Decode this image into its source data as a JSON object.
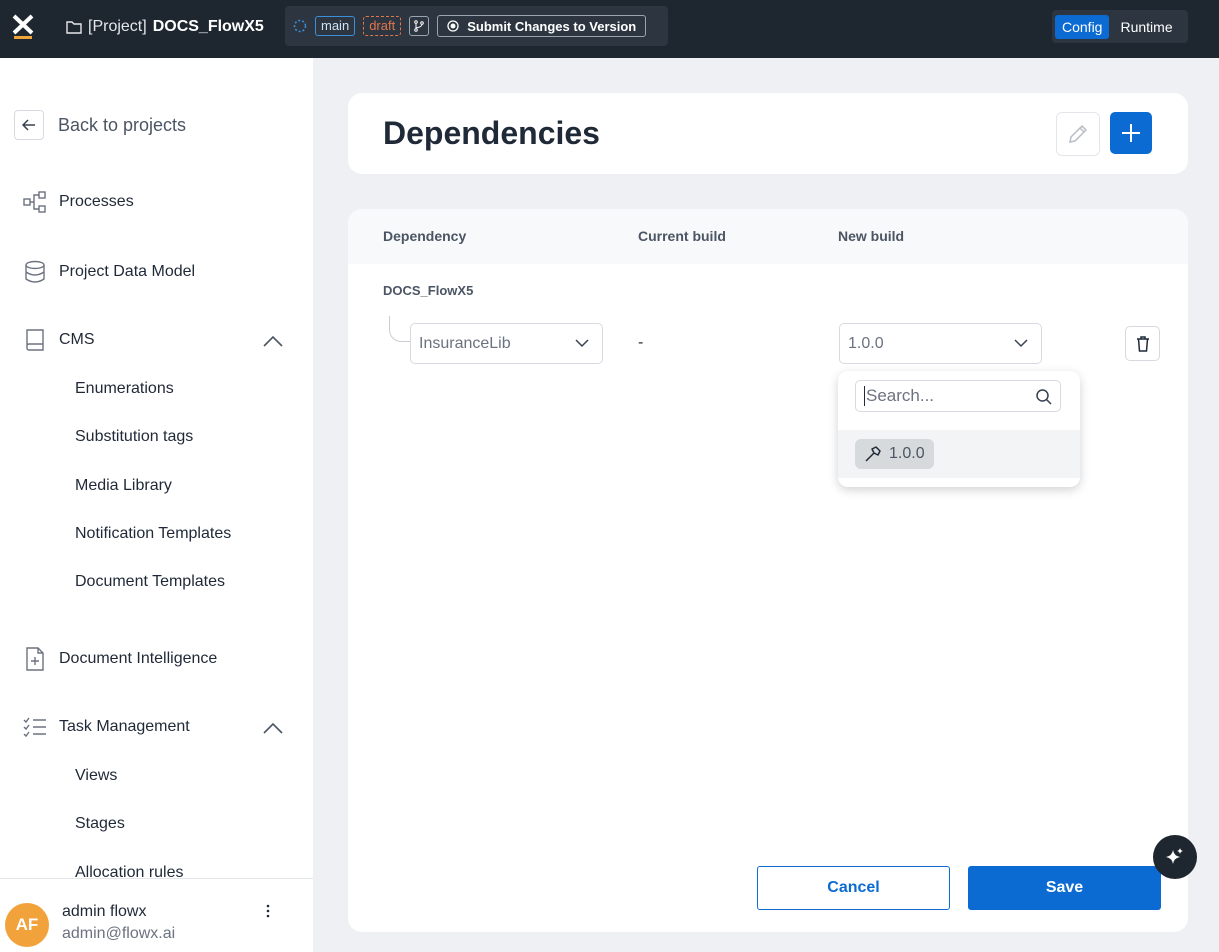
{
  "topbar": {
    "project_prefix": "[Project]",
    "project_name": "DOCS_FlowX5",
    "branch": "main",
    "status": "draft",
    "submit_label": "Submit Changes to Version",
    "modes": [
      "Config",
      "Runtime"
    ],
    "active_mode": "Config"
  },
  "sidebar": {
    "back_label": "Back to projects",
    "items": {
      "processes": "Processes",
      "data_model": "Project Data Model",
      "cms": "CMS",
      "doc_intel": "Document Intelligence",
      "task_mgmt": "Task Management"
    },
    "cms_children": [
      "Enumerations",
      "Substitution tags",
      "Media Library",
      "Notification Templates",
      "Document Templates"
    ],
    "task_children": [
      "Views",
      "Stages",
      "Allocation rules"
    ],
    "user": {
      "initials": "AF",
      "name": "admin flowx",
      "email": "admin@flowx.ai"
    }
  },
  "page": {
    "title": "Dependencies"
  },
  "table": {
    "columns": [
      "Dependency",
      "Current build",
      "New build"
    ],
    "group": "DOCS_FlowX5",
    "row": {
      "dependency": "InsuranceLib",
      "current_build": "-",
      "new_build": "1.0.0"
    }
  },
  "dropdown": {
    "search_placeholder": "Search...",
    "options": [
      "1.0.0"
    ]
  },
  "actions": {
    "cancel": "Cancel",
    "save": "Save"
  },
  "colors": {
    "accent": "#0b6bd3",
    "topbar": "#1e2630",
    "draft": "#e0764a",
    "avatar": "#f1a23a"
  }
}
